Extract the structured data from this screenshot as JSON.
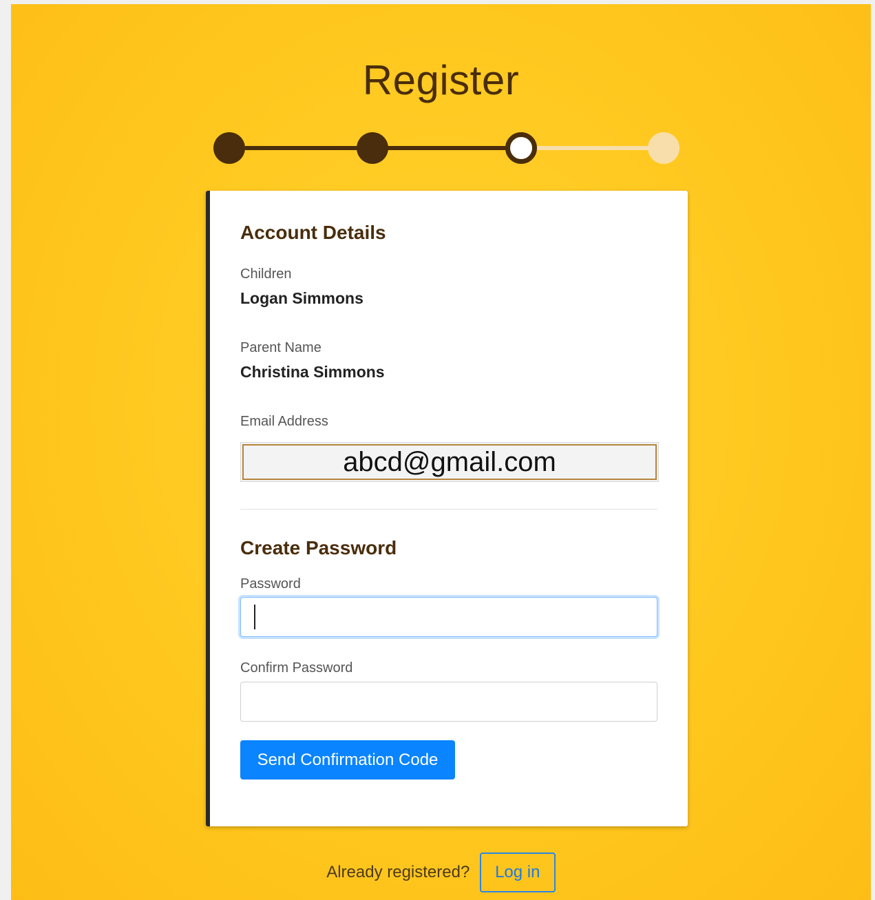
{
  "header": {
    "title": "Register"
  },
  "stepper": {
    "total_steps": 4,
    "current_step": 3
  },
  "account_details": {
    "heading": "Account Details",
    "children_label": "Children",
    "children_value": "Logan Simmons",
    "parent_label": "Parent Name",
    "parent_value": "Christina Simmons",
    "email_label": "Email Address",
    "email_value": "abcd@gmail.com"
  },
  "create_password": {
    "heading": "Create Password",
    "password_label": "Password",
    "password_value": "",
    "confirm_label": "Confirm Password",
    "confirm_value": "",
    "submit_label": "Send Confirmation Code"
  },
  "footer": {
    "prompt": "Already registered?",
    "login_label": "Log in"
  },
  "colors": {
    "background": "#ffc81f",
    "brown": "#4a2d0c",
    "step_inactive": "#f8deaa",
    "primary": "#0a84ff"
  }
}
